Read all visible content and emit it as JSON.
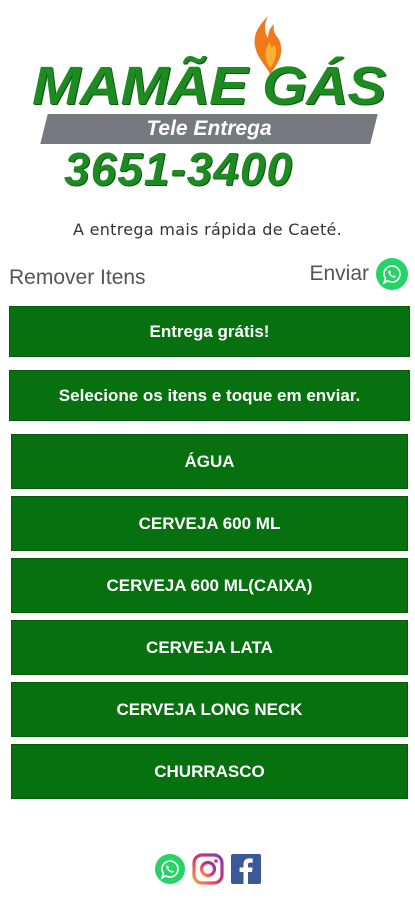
{
  "logo": {
    "title": "MAMÃE GÁS",
    "subtitle": "Tele Entrega",
    "phone": "3651-3400"
  },
  "tagline": "A entrega mais rápida de Caeté.",
  "actions": {
    "remove_label": "Remover Itens",
    "send_label": "Enviar"
  },
  "info": {
    "free_delivery": "Entrega grátis!",
    "instructions": "Selecione os itens e toque em enviar."
  },
  "items": [
    "ÁGUA",
    "CERVEJA 600 ML",
    "CERVEJA 600 ML(CAIXA)",
    "CERVEJA LATA",
    "CERVEJA LONG NECK",
    "CHURRASCO"
  ],
  "colors": {
    "primary_green": "#07700f",
    "logo_green": "#1e8a22",
    "band_gray": "#767a7e",
    "whatsapp": "#25d366"
  },
  "icons": {
    "send": "whatsapp-icon",
    "footer": [
      "whatsapp-icon",
      "instagram-icon",
      "facebook-icon"
    ]
  }
}
